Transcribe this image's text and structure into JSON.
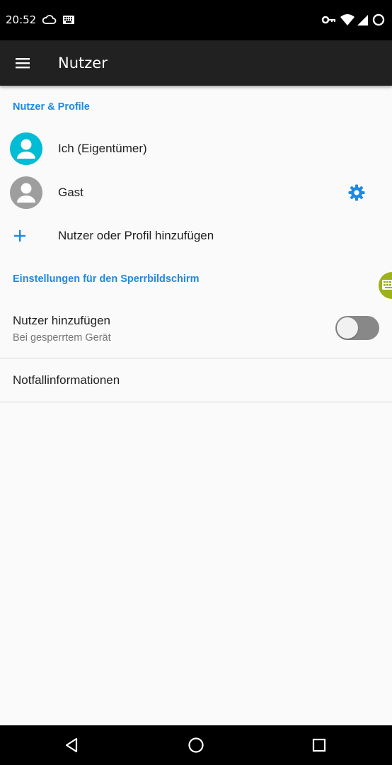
{
  "status_bar": {
    "time": "20:52",
    "icons": [
      "cloud-icon",
      "keyboard-icon",
      "vpn-key-icon",
      "wifi-icon",
      "signal-icon",
      "data-saver-icon"
    ]
  },
  "toolbar": {
    "title": "Nutzer",
    "menu_icon": "menu-icon"
  },
  "sections": {
    "users_header": "Nutzer & Profile",
    "lockscreen_header": "Einstellungen für den Sperrbildschirm"
  },
  "users": [
    {
      "label": "Ich (Eigentümer)",
      "avatar_color": "#00bcd4",
      "icon": "person-icon"
    },
    {
      "label": "Gast",
      "avatar_color": "#9e9e9e",
      "icon": "person-icon",
      "action_icon": "gear-icon"
    }
  ],
  "add_user": {
    "label": "Nutzer oder Profil hinzufügen",
    "icon": "plus-icon"
  },
  "lockscreen": {
    "add_users_title": "Nutzer hinzufügen",
    "add_users_summary": "Bei gesperrtem Gerät",
    "add_users_enabled": false,
    "emergency_info": "Notfallinformationen"
  },
  "colors": {
    "accent": "#1e88e5",
    "toolbar": "#212121",
    "keyboard_bubble": "#9cb11c"
  },
  "nav_bar": {
    "icons": [
      "back-icon",
      "home-icon",
      "recents-icon"
    ]
  }
}
